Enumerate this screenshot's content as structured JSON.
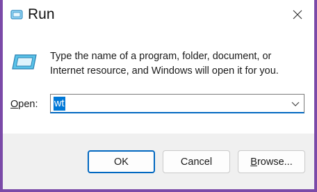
{
  "window": {
    "title": "Run",
    "accent_color": "#7b4aa8",
    "icons": {
      "app": "run-app-icon",
      "close": "close-icon",
      "dialog": "run-dialog-icon",
      "dropdown": "chevron-down-icon"
    }
  },
  "dialog": {
    "description_line1": "Type the name of a program, folder, document, or",
    "description_line2": "Internet resource, and Windows will open it for you.",
    "open_label_accel": "O",
    "open_label_rest": "pen:",
    "open_value": "wt"
  },
  "buttons": {
    "ok": "OK",
    "cancel": "Cancel",
    "browse_accel": "B",
    "browse_rest": "rowse..."
  }
}
